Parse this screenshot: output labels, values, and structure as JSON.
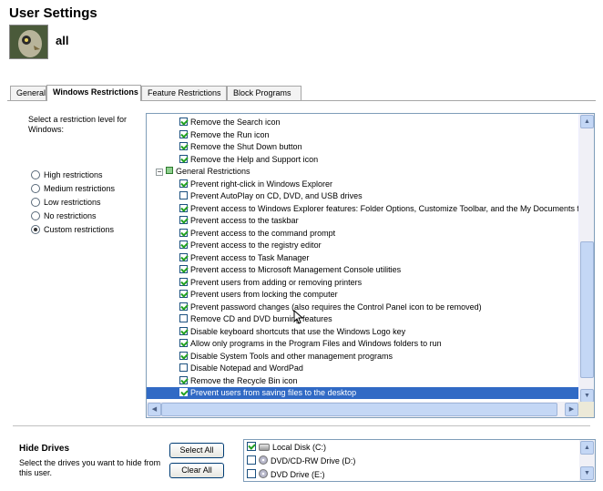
{
  "header": {
    "title": "User Settings",
    "user_name": "all"
  },
  "tabs": [
    {
      "label": "General",
      "active": false
    },
    {
      "label": "Windows Restrictions",
      "active": true
    },
    {
      "label": "Feature Restrictions",
      "active": false
    },
    {
      "label": "Block Programs",
      "active": false
    }
  ],
  "restriction_level": {
    "label": "Select a restriction level for Windows:",
    "options": [
      {
        "label": "High restrictions",
        "checked": false
      },
      {
        "label": "Medium restrictions",
        "checked": false
      },
      {
        "label": "Low restrictions",
        "checked": false
      },
      {
        "label": "No restrictions",
        "checked": false
      },
      {
        "label": "Custom restrictions",
        "checked": true
      }
    ]
  },
  "restrictions_tree": {
    "items": [
      {
        "label": "Remove the Search icon",
        "checked": true,
        "level": 1
      },
      {
        "label": "Remove the Run icon",
        "checked": true,
        "level": 1
      },
      {
        "label": "Remove the Shut Down button",
        "checked": true,
        "level": 1
      },
      {
        "label": "Remove the Help and Support icon",
        "checked": true,
        "level": 1
      },
      {
        "label": "General Restrictions",
        "group": true,
        "expander": "−",
        "level": 0
      },
      {
        "label": "Prevent right-click in Windows Explorer",
        "checked": true,
        "level": 1
      },
      {
        "label": "Prevent AutoPlay on CD, DVD, and USB drives",
        "checked": false,
        "level": 1
      },
      {
        "label": "Prevent access to Windows Explorer features: Folder Options, Customize Toolbar, and the My Documents fo",
        "checked": true,
        "level": 1
      },
      {
        "label": "Prevent access to the taskbar",
        "checked": true,
        "level": 1
      },
      {
        "label": "Prevent access to the command prompt",
        "checked": true,
        "level": 1
      },
      {
        "label": "Prevent access to the registry editor",
        "checked": true,
        "level": 1
      },
      {
        "label": "Prevent access to Task Manager",
        "checked": true,
        "level": 1
      },
      {
        "label": "Prevent access to Microsoft Management Console utilities",
        "checked": true,
        "level": 1
      },
      {
        "label": "Prevent users from adding or removing printers",
        "checked": true,
        "level": 1
      },
      {
        "label": "Prevent users from locking the computer",
        "checked": true,
        "level": 1
      },
      {
        "label": "Prevent password changes (also requires the Control Panel icon to be removed)",
        "checked": true,
        "level": 1
      },
      {
        "label": "Remove CD and DVD burning features",
        "checked": false,
        "level": 1
      },
      {
        "label": "Disable keyboard shortcuts that use the Windows Logo key",
        "checked": true,
        "level": 1
      },
      {
        "label": "Allow only programs in the Program Files and Windows folders to run",
        "checked": true,
        "level": 1
      },
      {
        "label": "Disable System Tools and other management programs",
        "checked": true,
        "level": 1
      },
      {
        "label": "Disable Notepad and WordPad",
        "checked": false,
        "level": 1
      },
      {
        "label": "Remove the Recycle Bin icon",
        "checked": true,
        "level": 1
      },
      {
        "label": "Prevent users from saving files to the desktop",
        "checked": true,
        "level": 1,
        "selected": true
      }
    ],
    "scroll_up_glyph": "▲",
    "scroll_down_glyph": "▼",
    "scroll_left_glyph": "◀",
    "scroll_right_glyph": "▶"
  },
  "hide_drives": {
    "title": "Hide Drives",
    "description": "Select the drives you want to hide from this user.",
    "select_all_label": "Select All",
    "clear_all_label": "Clear All",
    "drives": [
      {
        "label": "Local Disk (C:)",
        "checked": true,
        "icon": "hard-disk-icon"
      },
      {
        "label": "DVD/CD-RW Drive (D:)",
        "checked": false,
        "icon": "dvd-drive-icon"
      },
      {
        "label": "DVD Drive (E:)",
        "checked": false,
        "icon": "dvd-drive-icon"
      }
    ]
  }
}
